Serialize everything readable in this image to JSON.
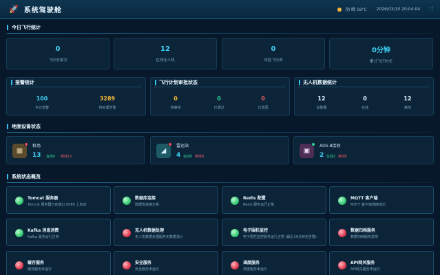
{
  "header": {
    "logo_icon": "rocket-icon",
    "title": "系统驾驶舱",
    "weather": "阴 晴 18°C",
    "datetime": "2026/03/10 20:04:04"
  },
  "today": {
    "title": "今日飞行统计",
    "stats": [
      {
        "value": "0",
        "label": "飞行总架次"
      },
      {
        "value": "12",
        "label": "在线无人机"
      },
      {
        "value": "0",
        "label": "试验飞行员"
      },
      {
        "value": "0分钟",
        "label": "累计飞行时长"
      }
    ]
  },
  "alarm": {
    "title": "报警统计",
    "items": [
      {
        "value": "100",
        "label": "今日告警",
        "color": "#3fd0f5"
      },
      {
        "value": "3289",
        "label": "待处理告警",
        "color": "#f4b63b"
      }
    ]
  },
  "plan": {
    "title": "飞行计划审批状态",
    "items": [
      {
        "value": "0",
        "label": "待审核",
        "color": "#f4b63b"
      },
      {
        "value": "0",
        "label": "已通过",
        "color": "#35d59a"
      },
      {
        "value": "0",
        "label": "已驳回",
        "color": "#ef5a6a"
      }
    ]
  },
  "drones": {
    "title": "无人机数据统计",
    "items": [
      {
        "value": "12",
        "label": "总数量",
        "color": "#e8f6ff"
      },
      {
        "value": "0",
        "label": "在线",
        "color": "#e8f6ff"
      },
      {
        "value": "12",
        "label": "离线",
        "color": "#e8f6ff"
      }
    ]
  },
  "ground": {
    "title": "地面设备状态",
    "devices": [
      {
        "name": "机场",
        "count": "13",
        "online": "在线0",
        "offline": "离线13",
        "icon": "airport-icon",
        "bg": "#5a4a2c",
        "glyph": "▦"
      },
      {
        "name": "雷达站",
        "count": "4",
        "online": "在线0",
        "offline": "离线4",
        "icon": "radar-icon",
        "bg": "#1d5a66",
        "glyph": "◢"
      },
      {
        "name": "ADS-B接收",
        "count": "2",
        "online": "在线2",
        "offline": "离线0",
        "icon": "adsb-receiver-icon",
        "bg": "#4e2e55",
        "glyph": "▣"
      }
    ]
  },
  "system": {
    "title": "系统状态概览",
    "services": [
      {
        "name": "Tomcat 服务器",
        "desc": "Tomcat 服务器已在端口 8080 上启动",
        "status": "green"
      },
      {
        "name": "数据库连接",
        "desc": "数据库连接正常",
        "status": "green"
      },
      {
        "name": "Redis 配置",
        "desc": "Redis 服务运行正常",
        "status": "green"
      },
      {
        "name": "MQTT 客户端",
        "desc": "MQTT 客户端连接成功",
        "status": "green"
      },
      {
        "name": "Kafka 消息消费",
        "desc": "Kafka 服务运行正常",
        "status": "green"
      },
      {
        "name": "无人机数据处理",
        "desc": "无人机数据处理服务无数据流入",
        "status": "red"
      },
      {
        "name": "电子围栏监控",
        "desc": "电子围栏监控服务运行正常 (最近10分钟无告警)",
        "status": "green"
      },
      {
        "name": "数据归档服务",
        "desc": "数据归档服务异常",
        "status": "red"
      },
      {
        "name": "缓存服务",
        "desc": "缓存服务未运行",
        "status": "red"
      },
      {
        "name": "安全服务",
        "desc": "安全服务未运行",
        "status": "red"
      },
      {
        "name": "调度服务",
        "desc": "调度服务未运行",
        "status": "red"
      },
      {
        "name": "API网关服务",
        "desc": "API网关服务未运行",
        "status": "red"
      }
    ]
  }
}
